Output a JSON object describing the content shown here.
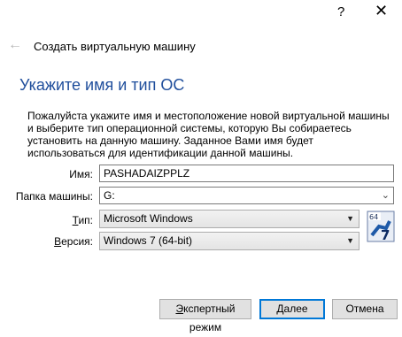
{
  "window": {
    "help_label": "?",
    "close_label": "✕"
  },
  "wizard": {
    "back_glyph": "←",
    "title": "Создать виртуальную машину",
    "heading": "Укажите имя и тип ОС",
    "description": "Пожалуйста укажите имя и местоположение новой виртуальной машины и выберите тип операционной системы, которую Вы собираетесь установить на данную машину. Заданное Вами имя будет использоваться для идентификации данной машины."
  },
  "form": {
    "name_label": "Имя:",
    "name_value": "PASHADAIZPPLZ",
    "folder_label": "Папка машины:",
    "folder_value": "G:",
    "type_label_prefix": "Т",
    "type_label_rest": "ип:",
    "type_value": "Microsoft Windows",
    "version_label_prefix": "В",
    "version_label_rest": "ерсия:",
    "version_value": "Windows 7 (64-bit)",
    "os_icon_badge": "64",
    "os_icon_number": "7"
  },
  "buttons": {
    "expert_prefix": "Э",
    "expert_rest": "кспертный режим",
    "next_prefix": "Д",
    "next_rest": "алее",
    "cancel_label": "Отмена"
  },
  "icons": {
    "help": "help-icon",
    "close": "close-icon",
    "back": "back-arrow-icon",
    "dropdown": "chevron-down-icon",
    "os": "windows-7-64bit-icon"
  }
}
